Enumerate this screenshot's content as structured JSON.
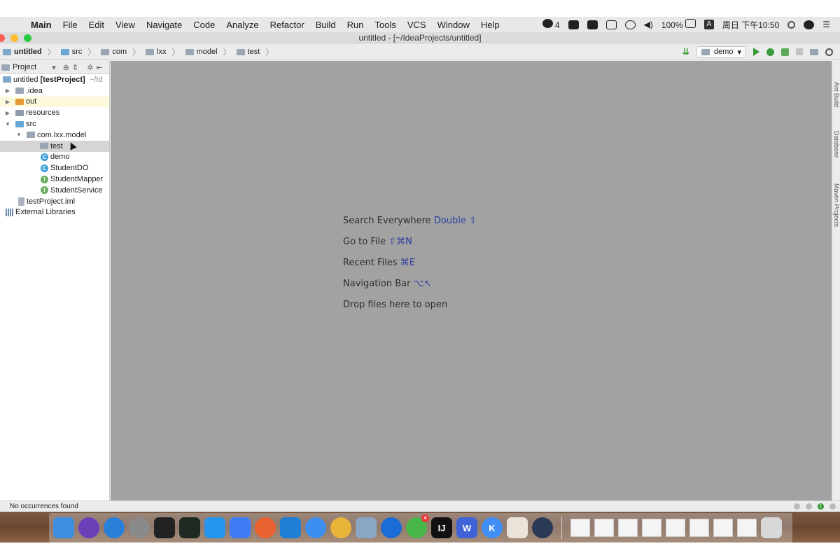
{
  "menubar": {
    "app_name": "Main",
    "items": [
      "File",
      "Edit",
      "View",
      "Navigate",
      "Code",
      "Analyze",
      "Refactor",
      "Build",
      "Run",
      "Tools",
      "VCS",
      "Window",
      "Help"
    ],
    "wechat_count": "4",
    "battery": "100%",
    "input_method": "A",
    "clock": "周日 下午10:50"
  },
  "window": {
    "title": "untitled - [~/IdeaProjects/untitled]"
  },
  "breadcrumb": [
    "untitled",
    "src",
    "com",
    "lxx",
    "model",
    "test"
  ],
  "run_config": {
    "name": "demo"
  },
  "project_panel": {
    "title": "Project",
    "tree": [
      {
        "label": "untitled",
        "bold_suffix": "[testProject]",
        "hint": "~/Id"
      },
      {
        "label": ".idea"
      },
      {
        "label": "out"
      },
      {
        "label": "resources"
      },
      {
        "label": "src"
      },
      {
        "label": "com.lxx.model"
      },
      {
        "label": "test"
      },
      {
        "label": "demo"
      },
      {
        "label": "StudentDO"
      },
      {
        "label": "StudentMapper"
      },
      {
        "label": "StudentService"
      },
      {
        "label": "testProject.iml"
      },
      {
        "label": "External Libraries"
      }
    ],
    "class_badge": "C",
    "interface_badge": "I"
  },
  "editor": {
    "hints": [
      {
        "text": "Search Everywhere",
        "key": "Double ⇧"
      },
      {
        "text": "Go to File",
        "key": "⇧⌘N"
      },
      {
        "text": "Recent Files",
        "key": "⌘E"
      },
      {
        "text": "Navigation Bar",
        "key": "⌥↖"
      },
      {
        "text": "Drop files here to open",
        "key": ""
      }
    ]
  },
  "right_tabs": [
    "Ant Build",
    "Database",
    "Maven Projects"
  ],
  "status": {
    "message": "No occurrences found",
    "badge": "1"
  },
  "dock": {
    "apps": [
      {
        "name": "Finder",
        "color": "#3b8ee0"
      },
      {
        "name": "Siri",
        "color": "#6a3fb8"
      },
      {
        "name": "Safari",
        "color": "#2a7fd8"
      },
      {
        "name": "System Preferences",
        "color": "#8a8a8a"
      },
      {
        "name": "Terminal",
        "color": "#222222"
      },
      {
        "name": "Activity Monitor",
        "color": "#1f2a22"
      },
      {
        "name": "Docker",
        "color": "#2496ed"
      },
      {
        "name": "Feishu",
        "color": "#3f7cf5"
      },
      {
        "name": "Paw",
        "color": "#e9622f"
      },
      {
        "name": "VS Code",
        "color": "#1f7fd4"
      },
      {
        "name": "Notes",
        "color": "#3c8ef0"
      },
      {
        "name": "Chrome",
        "color": "#e9b43a"
      },
      {
        "name": "Preview",
        "color": "#8aa6c4"
      },
      {
        "name": "Maps",
        "color": "#1b6cd6"
      },
      {
        "name": "WeChat",
        "color": "#49b649"
      },
      {
        "name": "IntelliJ IDEA",
        "color": "#111111"
      },
      {
        "name": "WPS",
        "color": "#3f63d6"
      },
      {
        "name": "Kuaipan",
        "color": "#3e8ef5"
      },
      {
        "name": "Java",
        "color": "#e9e3d9"
      },
      {
        "name": "QuickTime",
        "color": "#2b3a55"
      }
    ],
    "wechat_badge": "4",
    "intellij_label": "IJ",
    "wps_label": "W",
    "k_label": "K"
  }
}
